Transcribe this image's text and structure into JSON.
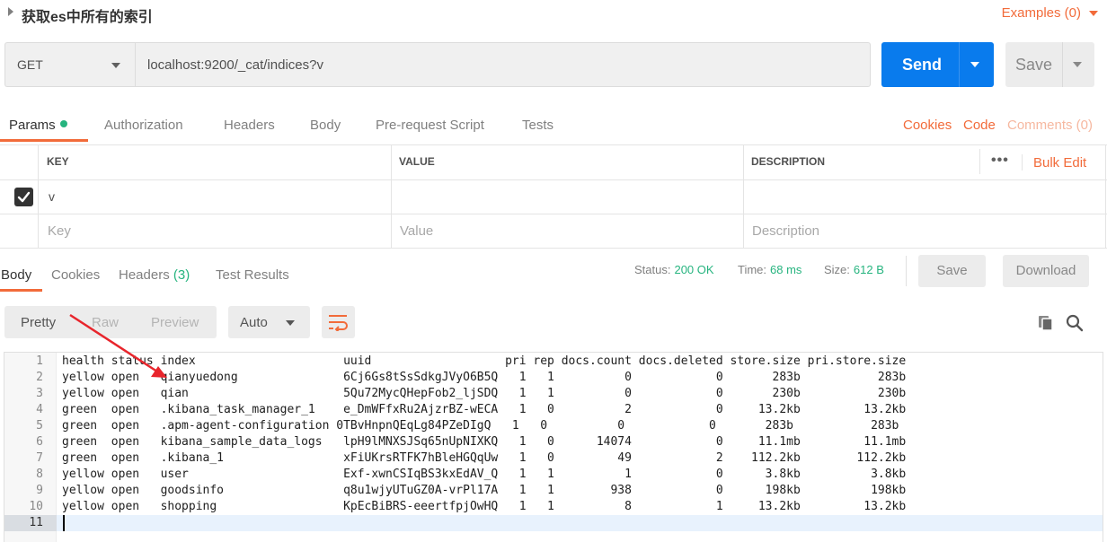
{
  "request": {
    "title": "获取es中所有的索引",
    "examples_label": "Examples (0)",
    "method": "GET",
    "url": "localhost:9200/_cat/indices?v",
    "send_label": "Send",
    "save_label": "Save"
  },
  "request_tabs": {
    "params": "Params",
    "authorization": "Authorization",
    "headers": "Headers",
    "body": "Body",
    "prerequest": "Pre-request Script",
    "tests": "Tests",
    "cookies": "Cookies",
    "code": "Code",
    "comments": "Comments (0)"
  },
  "params_table": {
    "headers": {
      "key": "KEY",
      "value": "VALUE",
      "description": "DESCRIPTION"
    },
    "bulk_edit": "Bulk Edit",
    "rows": [
      {
        "key": "v",
        "value": "",
        "description": "",
        "checked": true
      }
    ],
    "placeholders": {
      "key": "Key",
      "value": "Value",
      "description": "Description"
    }
  },
  "response_tabs": {
    "body": "Body",
    "cookies": "Cookies",
    "headers": "Headers",
    "headers_count": "(3)",
    "test_results": "Test Results"
  },
  "response_meta": {
    "status_label": "Status:",
    "status_value": "200 OK",
    "time_label": "Time:",
    "time_value": "68 ms",
    "size_label": "Size:",
    "size_value": "612 B",
    "save_label": "Save",
    "download_label": "Download"
  },
  "response_toolbar": {
    "pretty": "Pretty",
    "raw": "Raw",
    "preview": "Preview",
    "format": "Auto",
    "icons": [
      "wrap-icon",
      "copy-icon",
      "search-icon"
    ]
  },
  "response_lines": [
    "health status index                     uuid                   pri rep docs.count docs.deleted store.size pri.store.size",
    "yellow open   qianyuedong               6Cj6Gs8tSsSdkgJVyO6B5Q   1   1          0            0       283b           283b",
    "yellow open   qian                      5Qu72MycQHepFob2_ljSDQ   1   1          0            0       230b           230b",
    "green  open   .kibana_task_manager_1    e_DmWFfxRu2AjzrBZ-wECA   1   0          2            0     13.2kb         13.2kb",
    "green  open   .apm-agent-configuration 0TBvHnpnQEqLg84PZeDIgQ   1   0          0            0       283b           283b",
    "green  open   kibana_sample_data_logs   lpH9lMNXSJSq65nUpNIXKQ   1   0      14074            0     11.1mb         11.1mb",
    "green  open   .kibana_1                 xFiUKrsRTFK7hBleHGQqUw   1   0         49            2    112.2kb        112.2kb",
    "yellow open   user                      Exf-xwnCSIqBS3kxEdAV_Q   1   1          1            0      3.8kb          3.8kb",
    "yellow open   goodsinfo                 q8u1wjyUTuGZ0A-vrPl17A   1   1        938            0      198kb          198kb",
    "yellow open   shopping                  KpEcBiBRS-eeertfpjOwHQ   1   1          8            1     13.2kb         13.2kb",
    ""
  ],
  "colors": {
    "accent": "#f26b3a",
    "send": "#097bed",
    "success": "#26b47f",
    "annotation_arrow": "#e8252c"
  }
}
